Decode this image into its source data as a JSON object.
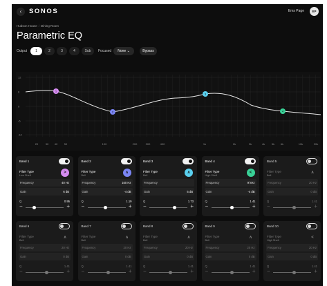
{
  "app": {
    "logo": "SONOS",
    "user_name": "Ems Page",
    "user_initials": "EP"
  },
  "breadcrumb": [
    "Hudson House",
    "Dining Room"
  ],
  "page_title": "Parametric EQ",
  "controls": {
    "output_label": "Output",
    "outputs": [
      "1",
      "2",
      "3",
      "4",
      "Sub"
    ],
    "selected_output": "1",
    "focused_label": "Focused",
    "focused_value": "None",
    "bypass_label": "Bypass"
  },
  "graph": {
    "y_ticks": [
      "12",
      "6",
      "0",
      "-6",
      "-12"
    ],
    "x_ticks": [
      "20",
      "30",
      "40",
      "50",
      "100",
      "200",
      "300",
      "400",
      "1k",
      "2k",
      "3k",
      "4k",
      "5k",
      "6k",
      "10k",
      "20k"
    ],
    "colors": {
      "band1": "#d58cf0",
      "band2": "#7b86f5",
      "band3": "#5ad0ef",
      "band4": "#39d197"
    }
  },
  "bands": [
    {
      "label": "Band 1",
      "enabled": true,
      "filter_type_label": "Filter Type",
      "filter_type": "Low Shelf",
      "frequency_label": "Frequency",
      "frequency": "40 Hz",
      "gain_label": "Gain",
      "gain": "6 dB",
      "q_label": "Q",
      "q": "0.95",
      "q_level": 0.18,
      "icon": "low-shelf-icon",
      "color": "#d58cf0",
      "glyph": ">"
    },
    {
      "label": "Band 2",
      "enabled": true,
      "filter_type_label": "Filter Type",
      "filter_type": "Bell",
      "frequency_label": "Frequency",
      "frequency": "160 Hz",
      "gain_label": "Gain",
      "gain": "-4 dB",
      "q_label": "Q",
      "q": "1.19",
      "q_level": 0.42,
      "icon": "bell-icon",
      "color": "#7b86f5",
      "glyph": "ʌ"
    },
    {
      "label": "Band 3",
      "enabled": true,
      "filter_type_label": "Filter Type",
      "filter_type": "Bell",
      "frequency_label": "Frequency",
      "frequency": "",
      "gain_label": "Gain",
      "gain": "5 dB",
      "q_label": "Q",
      "q": "1.73",
      "q_level": 0.62,
      "icon": "bell-icon",
      "color": "#5ad0ef",
      "glyph": "ʌ"
    },
    {
      "label": "Band 4",
      "enabled": true,
      "filter_type_label": "Filter Type",
      "filter_type": "High Shelf",
      "frequency_label": "Frequency",
      "frequency": "9 kHz",
      "gain_label": "Gain",
      "gain": "-4 dB",
      "q_label": "Q",
      "q": "1.41",
      "q_level": 0.5,
      "icon": "high-shelf-icon",
      "color": "#39d197",
      "glyph": "<"
    },
    {
      "label": "Band 5",
      "enabled": false,
      "filter_type_label": "Filter Type",
      "filter_type": "Bell",
      "frequency_label": "Frequency",
      "frequency": "20 Hz",
      "gain_label": "Gain",
      "gain": "0 dB",
      "q_label": "Q",
      "q": "1.41",
      "q_level": 0.5,
      "icon": "bell-icon",
      "color": "",
      "glyph": "ʌ"
    },
    {
      "label": "Band 6",
      "enabled": false,
      "filter_type_label": "Filter Type",
      "filter_type": "Bell",
      "frequency_label": "Frequency",
      "frequency": "20 Hz",
      "gain_label": "Gain",
      "gain": "0 dB",
      "q_label": "Q",
      "q": "1.41",
      "q_level": 0.5,
      "icon": "bell-icon",
      "color": "",
      "glyph": "ʌ"
    },
    {
      "label": "Band 7",
      "enabled": false,
      "filter_type_label": "Filter Type",
      "filter_type": "Bell",
      "frequency_label": "Frequency",
      "frequency": "20 Hz",
      "gain_label": "Gain",
      "gain": "0 dB",
      "q_label": "Q",
      "q": "1.41",
      "q_level": 0.5,
      "icon": "bell-icon",
      "color": "",
      "glyph": "ʌ"
    },
    {
      "label": "Band 8",
      "enabled": false,
      "filter_type_label": "Filter Type",
      "filter_type": "Bell",
      "frequency_label": "Frequency",
      "frequency": "20 Hz",
      "gain_label": "Gain",
      "gain": "0 dB",
      "q_label": "Q",
      "q": "1.41",
      "q_level": 0.5,
      "icon": "bell-icon",
      "color": "",
      "glyph": "ʌ"
    },
    {
      "label": "Band 9",
      "enabled": false,
      "filter_type_label": "Filter Type",
      "filter_type": "Bell",
      "frequency_label": "Frequency",
      "frequency": "20 Hz",
      "gain_label": "Gain",
      "gain": "0 dB",
      "q_label": "Q",
      "q": "1.41",
      "q_level": 0.5,
      "icon": "bell-icon",
      "color": "",
      "glyph": "ʌ"
    },
    {
      "label": "Band 10",
      "enabled": false,
      "filter_type_label": "Filter Type",
      "filter_type": "High Shelf",
      "frequency_label": "Frequency",
      "frequency": "20 Hz",
      "gain_label": "Gain",
      "gain": "0 dB",
      "q_label": "Q",
      "q": "1.41",
      "q_level": 0.5,
      "icon": "high-shelf-icon",
      "color": "",
      "glyph": "<"
    }
  ]
}
